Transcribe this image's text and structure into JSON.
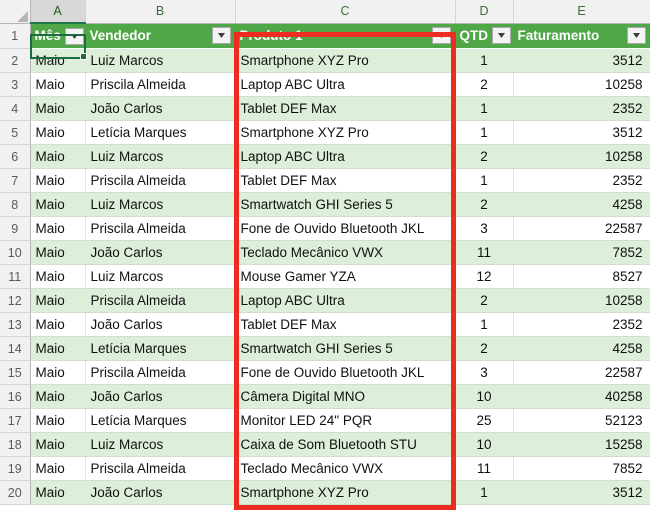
{
  "app": "spreadsheet",
  "colors": {
    "header_green": "#50a747",
    "band_green": "#ddeed9",
    "selection_green": "#1e6b41",
    "annotation_red": "#ee2b20"
  },
  "column_letters": [
    "A",
    "B",
    "C",
    "D",
    "E"
  ],
  "selected_cell": "A1",
  "selected_column_letter": "A",
  "annotated_column_letter": "C",
  "table": {
    "headers": [
      {
        "label": "Mês",
        "filter": true
      },
      {
        "label": "Vendedor",
        "filter": true
      },
      {
        "label": "Produto 1",
        "filter": true
      },
      {
        "label": "QTD",
        "filter": true
      },
      {
        "label": "Faturamento",
        "filter": true
      }
    ],
    "rows": [
      {
        "n": "2",
        "mes": "Maio",
        "vendedor": "Luiz Marcos",
        "produto": "Smartphone XYZ Pro",
        "qtd": "1",
        "faturamento": "3512"
      },
      {
        "n": "3",
        "mes": "Maio",
        "vendedor": "Priscila Almeida",
        "produto": "Laptop ABC Ultra",
        "qtd": "2",
        "faturamento": "10258"
      },
      {
        "n": "4",
        "mes": "Maio",
        "vendedor": "João Carlos",
        "produto": "Tablet DEF Max",
        "qtd": "1",
        "faturamento": "2352"
      },
      {
        "n": "5",
        "mes": "Maio",
        "vendedor": "Letícia Marques",
        "produto": "Smartphone XYZ Pro",
        "qtd": "1",
        "faturamento": "3512"
      },
      {
        "n": "6",
        "mes": "Maio",
        "vendedor": "Luiz Marcos",
        "produto": "Laptop ABC Ultra",
        "qtd": "2",
        "faturamento": "10258"
      },
      {
        "n": "7",
        "mes": "Maio",
        "vendedor": "Priscila Almeida",
        "produto": "Tablet DEF Max",
        "qtd": "1",
        "faturamento": "2352"
      },
      {
        "n": "8",
        "mes": "Maio",
        "vendedor": "Luiz Marcos",
        "produto": "Smartwatch GHI Series 5",
        "qtd": "2",
        "faturamento": "4258"
      },
      {
        "n": "9",
        "mes": "Maio",
        "vendedor": "Priscila Almeida",
        "produto": "Fone de Ouvido Bluetooth JKL",
        "qtd": "3",
        "faturamento": "22587"
      },
      {
        "n": "10",
        "mes": "Maio",
        "vendedor": "João Carlos",
        "produto": "Teclado Mecânico VWX",
        "qtd": "11",
        "faturamento": "7852"
      },
      {
        "n": "11",
        "mes": "Maio",
        "vendedor": "Luiz Marcos",
        "produto": "Mouse Gamer YZA",
        "qtd": "12",
        "faturamento": "8527"
      },
      {
        "n": "12",
        "mes": "Maio",
        "vendedor": "Priscila Almeida",
        "produto": "Laptop ABC Ultra",
        "qtd": "2",
        "faturamento": "10258"
      },
      {
        "n": "13",
        "mes": "Maio",
        "vendedor": "João Carlos",
        "produto": "Tablet DEF Max",
        "qtd": "1",
        "faturamento": "2352"
      },
      {
        "n": "14",
        "mes": "Maio",
        "vendedor": "Letícia Marques",
        "produto": "Smartwatch GHI Series 5",
        "qtd": "2",
        "faturamento": "4258"
      },
      {
        "n": "15",
        "mes": "Maio",
        "vendedor": "Priscila Almeida",
        "produto": "Fone de Ouvido Bluetooth JKL",
        "qtd": "3",
        "faturamento": "22587"
      },
      {
        "n": "16",
        "mes": "Maio",
        "vendedor": "João Carlos",
        "produto": "Câmera Digital MNO",
        "qtd": "10",
        "faturamento": "40258"
      },
      {
        "n": "17",
        "mes": "Maio",
        "vendedor": "Letícia Marques",
        "produto": "Monitor LED 24\" PQR",
        "qtd": "25",
        "faturamento": "52123"
      },
      {
        "n": "18",
        "mes": "Maio",
        "vendedor": "Luiz Marcos",
        "produto": "Caixa de Som Bluetooth STU",
        "qtd": "10",
        "faturamento": "15258"
      },
      {
        "n": "19",
        "mes": "Maio",
        "vendedor": "Priscila Almeida",
        "produto": "Teclado Mecânico VWX",
        "qtd": "11",
        "faturamento": "7852"
      },
      {
        "n": "20",
        "mes": "Maio",
        "vendedor": "João Carlos",
        "produto": "Smartphone XYZ Pro",
        "qtd": "1",
        "faturamento": "3512"
      }
    ]
  }
}
